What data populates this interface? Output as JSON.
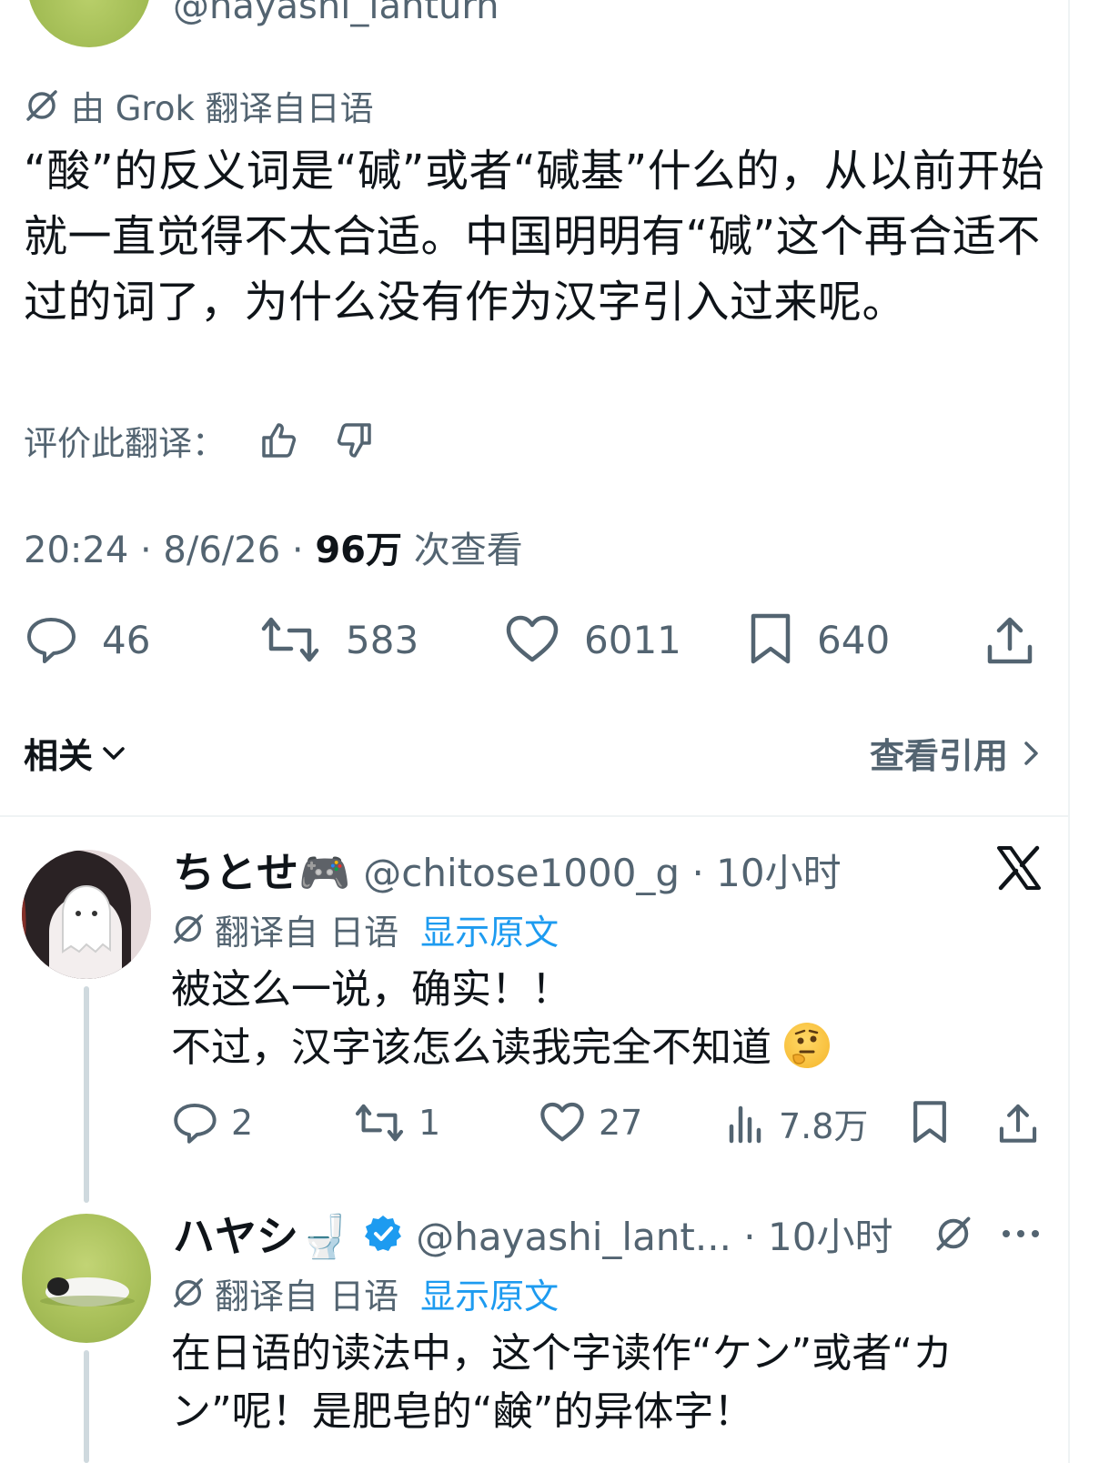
{
  "main_tweet": {
    "handle": "@hayashi_lanturn",
    "translation_note": "由 Grok 翻译自日语",
    "text": "“酸”的反义词是“碱”或者“碱基”什么的，从以前开始就一直觉得不太合适。中国明明有“碱”这个再合适不过的词了，为什么没有作为汉字引入过来呢。",
    "rate_label": "评价此翻译：",
    "time": "20:24 · 8/6/26 · ",
    "views_count": "96万",
    "views_label": " 次查看",
    "stats": {
      "replies": "46",
      "retweets": "583",
      "likes": "6011",
      "bookmarks": "640"
    }
  },
  "section": {
    "related_label": "相关",
    "quotes_label": "查看引用"
  },
  "replies": [
    {
      "name": "ちとせ🎮",
      "handle": "@chitose1000_g · 10小时",
      "translated_from": "翻译自 日语",
      "show_original": "显示原文",
      "line1": "被这么一说，确实！！",
      "line2": "不过，汉字该怎么读我完全不知道",
      "stats": {
        "replies": "2",
        "retweets": "1",
        "likes": "27",
        "views": "7.8万"
      }
    },
    {
      "name": "ハヤシ🚽",
      "handle": "@hayashi_lant... · 10小时",
      "translated_from": "翻译自 日语",
      "show_original": "显示原文",
      "line1": "在日语的读法中，这个字读作“ケン”或者“カ",
      "line2": "ン”呢！是肥皂的“鹸”的异体字！"
    }
  ],
  "colors": {
    "text_primary": "#0f1419",
    "text_secondary": "#536471",
    "accent_blue": "#1d9bf0",
    "divider": "#eff3f4"
  },
  "icons": {
    "grok": "grok-icon",
    "reply": "reply-icon",
    "retweet": "retweet-icon",
    "like": "heart-icon",
    "bookmark": "bookmark-icon",
    "share": "share-icon",
    "views": "views-icon",
    "verified": "verified-badge-icon",
    "x_logo": "x-logo-icon",
    "more": "more-icon"
  }
}
